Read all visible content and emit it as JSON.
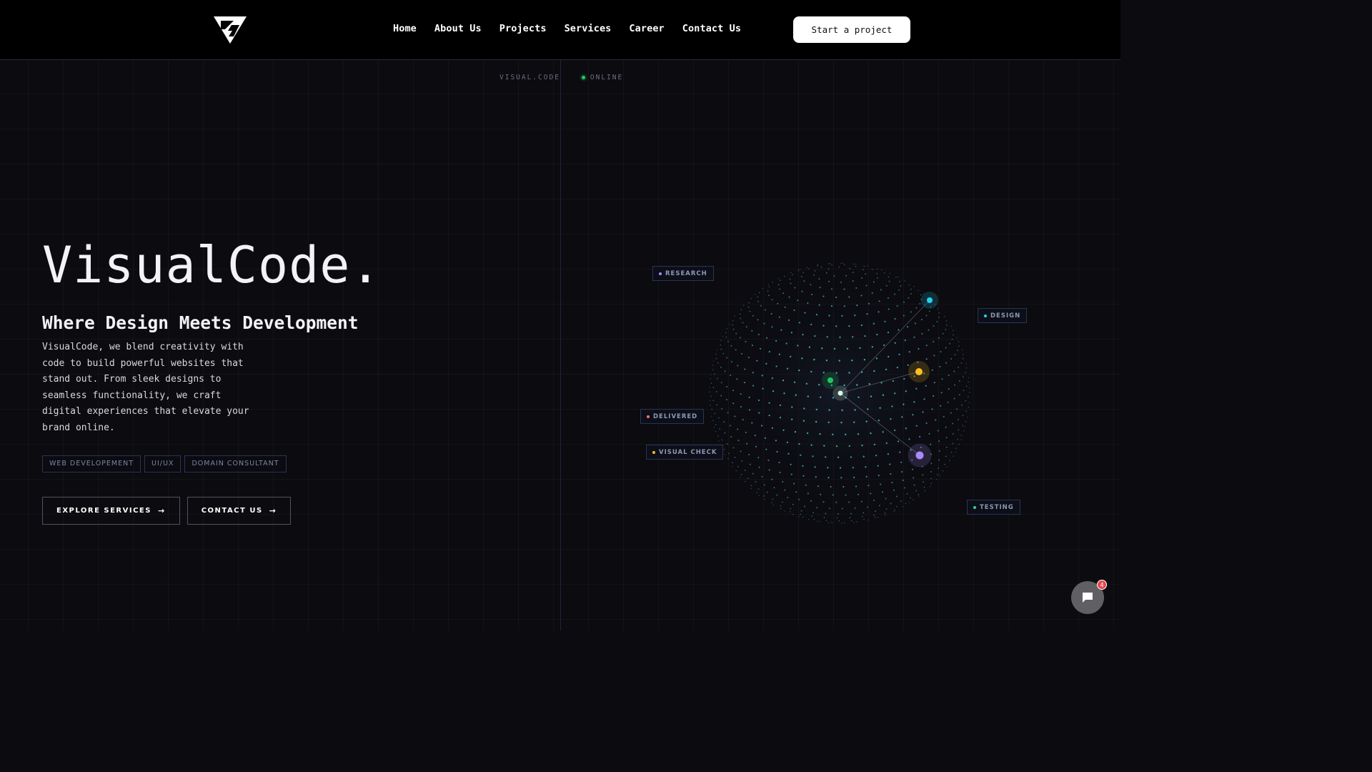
{
  "nav": {
    "items": [
      "Home",
      "About Us",
      "Projects",
      "Services",
      "Career",
      "Contact Us"
    ],
    "cta_label": "Start a project"
  },
  "status": {
    "brand": "VISUAL.CODE",
    "state": "ONLINE"
  },
  "hero": {
    "title": "VisualCode.",
    "subtitle": "Where Design Meets Development",
    "description": "VisualCode, we blend creativity with code to build powerful websites that stand out. From sleek designs to seamless functionality, we craft digital experiences that elevate your brand online.",
    "tags": [
      "WEB DEVELOPEMENT",
      "UI/UX",
      "DOMAIN CONSULTANT"
    ],
    "buttons": {
      "explore": "EXPLORE SERVICES",
      "contact": "CONTACT US"
    },
    "arrow": "→"
  },
  "sphere_labels": {
    "research": "RESEARCH",
    "design": "DESIGN",
    "delivered": "DELIVERED",
    "visual_check": "VISUAL CHECK",
    "testing": "TESTING"
  },
  "colors": {
    "accent_green": "#22c55e",
    "research": "#a78bfa",
    "design": "#22d3ee",
    "delivered": "#f87171",
    "visual_check": "#fbbf24",
    "testing": "#34d399"
  },
  "chat": {
    "unread_count": "4",
    "icon": "chat-bubble-icon"
  }
}
